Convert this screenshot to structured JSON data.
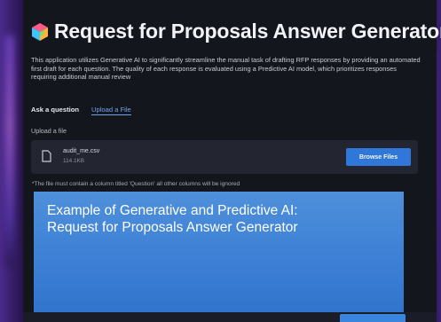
{
  "app": {
    "title": "Request for Proposals Answer Generator",
    "description": "This application utilizes Generative AI to significantly streamline the manual task of drafting RFP responses by providing an automated first draft for each question. The quality of each response is evaluated using a Predictive AI model, which prioritizes responses requiring additional manual review",
    "tabs": [
      {
        "label": "Ask a question",
        "active": true
      },
      {
        "label": "Upload a File",
        "active": false
      }
    ]
  },
  "upload": {
    "label": "Upload a file",
    "file_name": "audit_me.csv",
    "file_size": "114.1KB",
    "browse_label": "Browse Files",
    "note": "*The file must contain a column titled 'Question' all other columns will be ignored"
  },
  "caption": {
    "line1": "Example of Generative and Predictive AI:",
    "line2": "Request for Proposals Answer Generator"
  },
  "colors": {
    "accent": "#2f77d8",
    "link": "#6fa2ee",
    "overlay": "#3f82d6",
    "background": "#14161e"
  },
  "icons": {
    "title_icon": "cube-icon",
    "file_icon": "file-icon"
  }
}
